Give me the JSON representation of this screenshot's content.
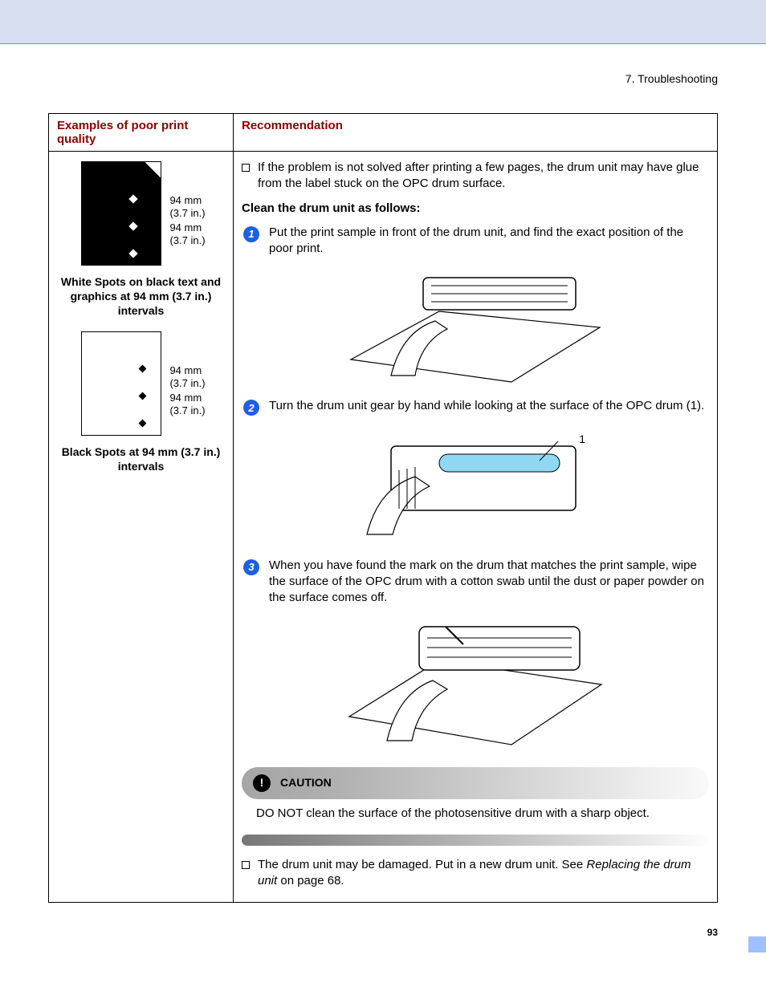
{
  "header": {
    "breadcrumb": "7. Troubleshooting"
  },
  "table": {
    "col1_header": "Examples of poor print quality",
    "col2_header": "Recommendation"
  },
  "examples": {
    "meas1": "94 mm",
    "meas1b": "(3.7 in.)",
    "meas2": "94 mm",
    "meas2b": "(3.7 in.)",
    "caption1": "White Spots on black text and graphics at 94 mm (3.7 in.) intervals",
    "meas3": "94 mm",
    "meas3b": "(3.7 in.)",
    "meas4": "94 mm",
    "meas4b": "(3.7 in.)",
    "caption2": "Black Spots at 94 mm (3.7 in.) intervals"
  },
  "rec": {
    "bullet1": "If the problem is not solved after printing a few pages, the drum unit may have glue from the label stuck on the OPC drum surface.",
    "instr_title": "Clean the drum unit as follows:",
    "step1_num": "1",
    "step1": "Put the print sample in front of the drum unit, and find the exact position of the poor print.",
    "step2_num": "2",
    "step2": "Turn the drum unit gear by hand while looking at the surface of the OPC drum (1).",
    "fig2_label": "1",
    "step3_num": "3",
    "step3": "When you have found the mark on the drum that matches the print sample, wipe the surface of the OPC drum with a cotton swab until the dust or paper powder on the surface comes off.",
    "caution_label": "CAUTION",
    "caution_text": "DO NOT clean the surface of the photosensitive drum with a sharp object.",
    "bullet2a": "The drum unit may be damaged. Put in a new drum unit. See ",
    "bullet2_link": "Replacing the drum unit",
    "bullet2b": " on page 68."
  },
  "page_number": "93"
}
